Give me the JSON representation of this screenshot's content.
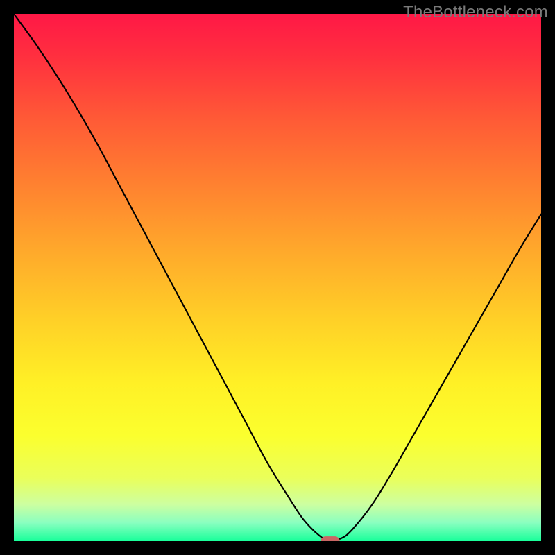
{
  "watermark": "TheBottleneck.com",
  "chart_data": {
    "type": "line",
    "title": "",
    "xlabel": "",
    "ylabel": "",
    "xlim": [
      0,
      100
    ],
    "ylim": [
      0,
      100
    ],
    "background_gradient_stops": [
      {
        "offset": 0.0,
        "color": "#ff1846"
      },
      {
        "offset": 0.08,
        "color": "#ff2f3f"
      },
      {
        "offset": 0.2,
        "color": "#ff5a36"
      },
      {
        "offset": 0.32,
        "color": "#ff8030"
      },
      {
        "offset": 0.45,
        "color": "#ffa92b"
      },
      {
        "offset": 0.58,
        "color": "#ffd027"
      },
      {
        "offset": 0.7,
        "color": "#fff026"
      },
      {
        "offset": 0.8,
        "color": "#fbff2e"
      },
      {
        "offset": 0.88,
        "color": "#eaff5a"
      },
      {
        "offset": 0.93,
        "color": "#cdffa0"
      },
      {
        "offset": 0.965,
        "color": "#8affc0"
      },
      {
        "offset": 1.0,
        "color": "#18ff9a"
      }
    ],
    "series": [
      {
        "name": "bottleneck-curve",
        "x": [
          0,
          4,
          8,
          12,
          16,
          20,
          24,
          28,
          32,
          36,
          40,
          44,
          48,
          52,
          55,
          58,
          60,
          62,
          64,
          68,
          72,
          76,
          80,
          84,
          88,
          92,
          96,
          100
        ],
        "y": [
          100,
          94.5,
          88.5,
          82.0,
          75.0,
          67.5,
          60.0,
          52.5,
          45.0,
          37.5,
          30.0,
          22.5,
          15.0,
          8.5,
          4.0,
          1.0,
          0.0,
          0.5,
          2.0,
          7.0,
          13.5,
          20.5,
          27.5,
          34.5,
          41.5,
          48.5,
          55.5,
          62.0
        ]
      }
    ],
    "marker": {
      "x": 60,
      "y": 0,
      "rx": 1.8,
      "ry": 0.9,
      "color": "#ca6664"
    },
    "annotations": []
  }
}
